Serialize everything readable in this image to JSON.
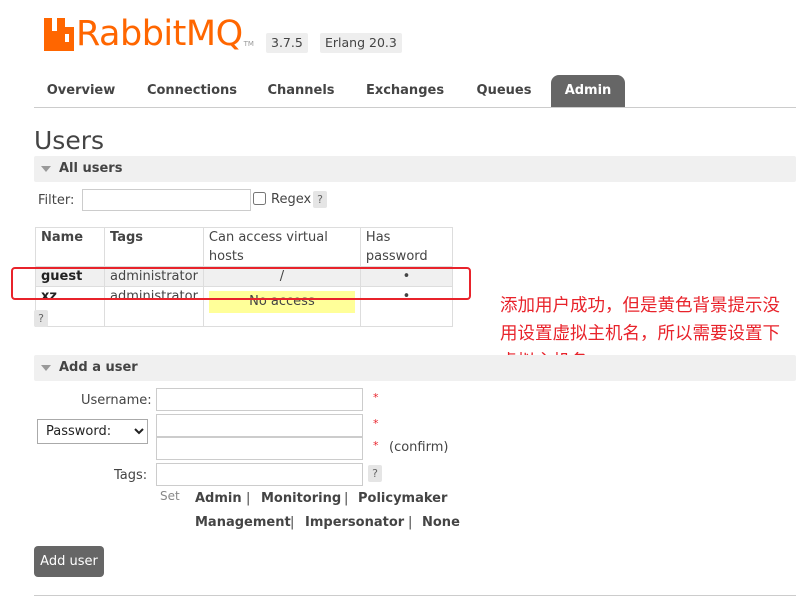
{
  "brand": {
    "name": "RabbitMQ",
    "tm": "TM",
    "version": "3.7.5",
    "erlang": "Erlang 20.3",
    "color": "#ff6600"
  },
  "tabs": [
    {
      "label": "Overview"
    },
    {
      "label": "Connections"
    },
    {
      "label": "Channels"
    },
    {
      "label": "Exchanges"
    },
    {
      "label": "Queues"
    },
    {
      "label": "Admin",
      "active": true
    }
  ],
  "page": {
    "title": "Users"
  },
  "all_users": {
    "title": "All users",
    "filter_label": "Filter:",
    "filter_value": "",
    "regex_label": "Regex",
    "help": "?",
    "columns": [
      "Name",
      "Tags",
      "Can access virtual hosts",
      "Has password"
    ],
    "rows": [
      {
        "name": "guest",
        "tags": "administrator",
        "vhosts": "/",
        "has_password": "•"
      },
      {
        "name": "xz",
        "tags": "administrator",
        "vhosts": "No access",
        "has_password": "•"
      }
    ]
  },
  "annotation": {
    "text": "添加用户成功，但是黄色背景提示没用设置虚拟主机名，所以需要设置下虚拟主机名",
    "color": "#e8232b"
  },
  "add_user": {
    "title": "Add a user",
    "username_label": "Username:",
    "password_option": "Password:",
    "confirm_label": "(confirm)",
    "tags_label": "Tags:",
    "required_mark": "*",
    "set_label": "Set",
    "tag_options": [
      "Admin",
      "Monitoring",
      "Policymaker",
      "Management",
      "Impersonator",
      "None"
    ],
    "separator": "|",
    "submit_label": "Add user"
  }
}
